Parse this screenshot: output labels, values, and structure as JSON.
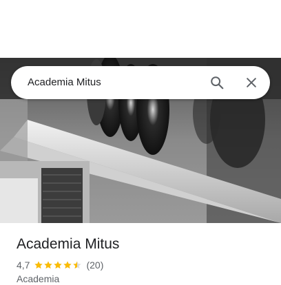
{
  "search": {
    "query": "Academia Mitus",
    "search_icon": "search-icon",
    "close_icon": "close-icon"
  },
  "hero": {
    "image": "gym-dumbbell-rack-photo"
  },
  "place": {
    "name": "Academia Mitus",
    "rating": "4,7",
    "rating_stars": 4.5,
    "review_count": "(20)",
    "category": "Academia"
  },
  "colors": {
    "star": "#fbbc04",
    "text_primary": "#202124",
    "text_secondary": "#5f6368"
  }
}
